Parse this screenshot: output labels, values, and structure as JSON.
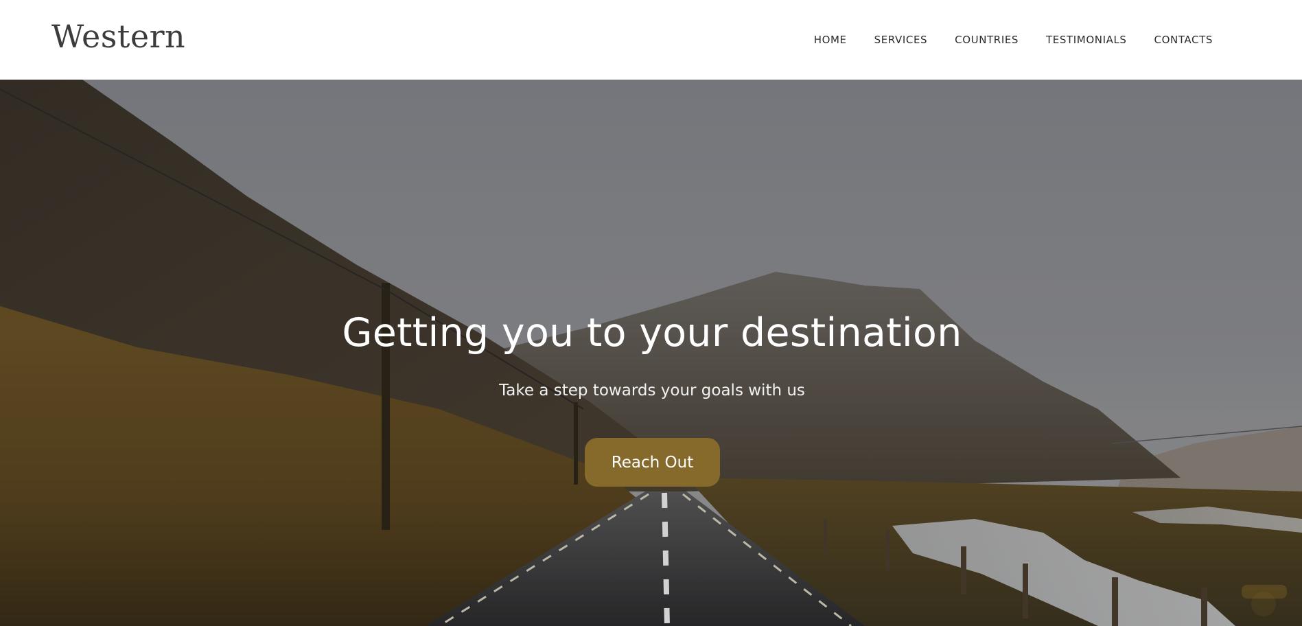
{
  "header": {
    "logo": "Western",
    "nav": [
      {
        "label": "HOME"
      },
      {
        "label": "SERVICES"
      },
      {
        "label": "COUNTRIES"
      },
      {
        "label": "TESTIMONIALS"
      },
      {
        "label": "CONTACTS"
      }
    ]
  },
  "hero": {
    "title": "Getting you to your destination",
    "subtitle": "Take a step towards your goals with us",
    "cta_label": "Reach Out",
    "image": "mountain-road-landscape"
  },
  "colors": {
    "accent": "#866a2c",
    "header_bg": "#ffffff",
    "logo_text": "#3c3c3c",
    "nav_text": "#2b2b2b",
    "hero_text": "#ffffff"
  }
}
